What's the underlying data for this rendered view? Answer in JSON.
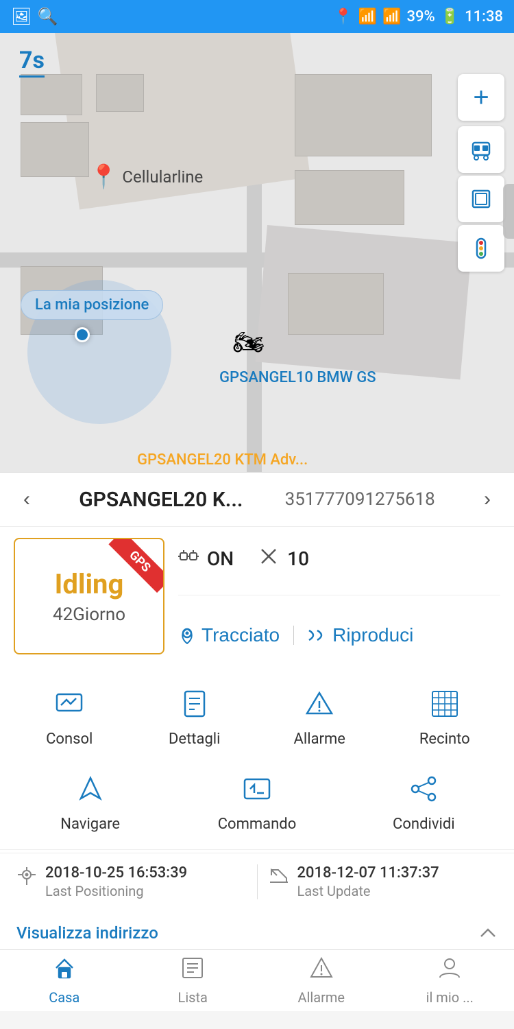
{
  "statusBar": {
    "time": "11:38",
    "battery": "39%",
    "icons": [
      "photo",
      "search",
      "location",
      "wifi",
      "signal",
      "battery"
    ]
  },
  "map": {
    "zoomLabel": "7s",
    "cellularlinePinLabel": "Cellularline",
    "myPositionTooltip": "La mia posizione",
    "deviceLabel1": "GPSANGEL10 BMW GS",
    "deviceLabel2": "GPSANGEL20 KTM Adv..."
  },
  "mapButtons": {
    "plus": "+",
    "bus": "🚌",
    "layers": "⧉",
    "traffic": "🚦"
  },
  "deviceHeader": {
    "prevBtn": "‹",
    "nextBtn": "›",
    "deviceName": "GPSANGEL20 K...",
    "deviceId": "351777091275618"
  },
  "statusBox": {
    "gpsBadge": "GPS",
    "statusMain": "Idling",
    "statusSub": "42Giorno"
  },
  "deviceDetails": {
    "engineIcon": "⚙",
    "engineStatus": "ON",
    "signalIcon": "✂",
    "signalValue": "10",
    "tracciatoIcon": "📍",
    "tracciatoLabel": "Tracciato",
    "riproduciIcon": "⏩",
    "riproduciLabel": "Riproduci"
  },
  "actionGrid": [
    {
      "icon": "📊",
      "label": "Consol"
    },
    {
      "icon": "📄",
      "label": "Dettagli"
    },
    {
      "icon": "⚠",
      "label": "Allarme"
    },
    {
      "icon": "⊞",
      "label": "Recinto"
    }
  ],
  "actionGrid2": [
    {
      "icon": "↗",
      "label": "Navigare"
    },
    {
      "icon": ">_",
      "label": "Commando"
    },
    {
      "icon": "⊗",
      "label": "Condividi"
    }
  ],
  "timestamps": {
    "lastPositioning": {
      "date": "2018-10-25 16:53:39",
      "label": "Last Positioning"
    },
    "lastUpdate": {
      "date": "2018-12-07 11:37:37",
      "label": "Last Update"
    }
  },
  "visualize": {
    "link": "Visualizza indirizzo",
    "collapseIcon": "^"
  },
  "bottomNav": [
    {
      "icon": "🏠",
      "label": "Casa",
      "active": true
    },
    {
      "icon": "☰",
      "label": "Lista",
      "active": false
    },
    {
      "icon": "⚠",
      "label": "Allarme",
      "active": false
    },
    {
      "icon": "👤",
      "label": "il mio ...",
      "active": false
    }
  ]
}
